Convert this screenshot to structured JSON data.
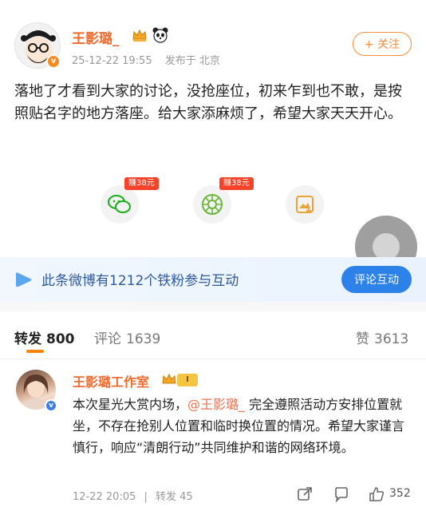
{
  "post": {
    "author": "王影璐_",
    "date": "25-12-22 19:55",
    "location": "发布于 北京",
    "follow_label": "+ 关注",
    "text": "落地了才看到大家的讨论，没抢座位，初来乍到也不敢，是按照贴名字的地方落座。给大家添麻烦了，希望大家天天开心。"
  },
  "share": {
    "wechat_reward": "赚38元",
    "moments_reward": "赚38元"
  },
  "banner": {
    "text": "此条微博有1212个铁粉参与互动",
    "button": "评论互动"
  },
  "tabs": {
    "repost_label": "转发",
    "repost_count": "800",
    "comment_label": "评论",
    "comment_count": "1639",
    "like_label": "赞",
    "like_count": "3613"
  },
  "repost": {
    "author": "王影璐工作室",
    "level": "I",
    "text_before": "本次星光大赏内场，",
    "mention": "@王影璐_",
    "text_after": " 完全遵照活动方安排位置就坐，不存在抢别人位置和临时换位置的情况。希望大家谨言慎行，响应“清朗行动”共同维护和谐的网络环境。",
    "time": "12-22 20:05",
    "separator": "|",
    "repost_info": "转发 45",
    "like_count": "352"
  },
  "colors": {
    "accent_orange": "#ff8200",
    "name_orange": "#f16b2f",
    "banner_blue": "#2c5aa0",
    "button_blue": "#2c82e8"
  }
}
